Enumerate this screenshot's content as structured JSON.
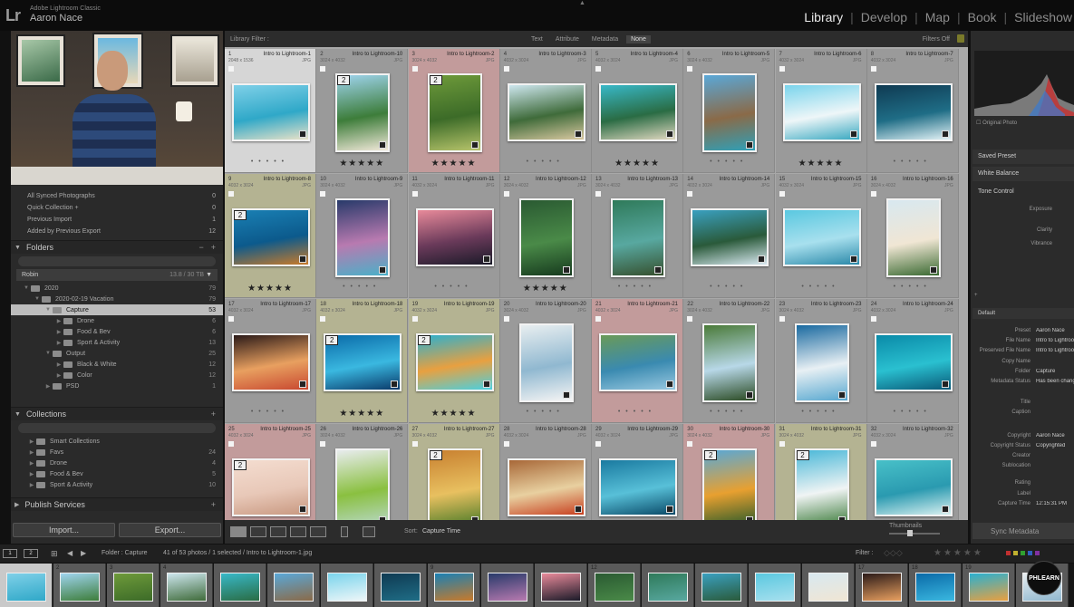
{
  "header": {
    "logo": "Lr",
    "app_name": "Adobe Lightroom Classic",
    "user_name": "Aaron Nace",
    "modules": [
      "Library",
      "Develop",
      "Map",
      "Book",
      "Slideshow"
    ],
    "active_module": "Library"
  },
  "catalog": [
    {
      "label": "All Synced Photographs",
      "count": "0"
    },
    {
      "label": "Quick Collection +",
      "count": "0"
    },
    {
      "label": "Previous Import",
      "count": "1"
    },
    {
      "label": "Added by Previous Export",
      "count": "12"
    }
  ],
  "folders": {
    "title": "Folders",
    "volume": "Robin",
    "volume_space": "13.8 / 30 TB",
    "tree": [
      {
        "name": "2020",
        "count": "79",
        "depth": 1,
        "expanded": true
      },
      {
        "name": "2020-02-19 Vacation",
        "count": "79",
        "depth": 2,
        "expanded": true
      },
      {
        "name": "Capture",
        "count": "53",
        "depth": 3,
        "expanded": true,
        "selected": true
      },
      {
        "name": "Drone",
        "count": "6",
        "depth": 4
      },
      {
        "name": "Food & Bev",
        "count": "6",
        "depth": 4
      },
      {
        "name": "Sport & Activity",
        "count": "13",
        "depth": 4
      },
      {
        "name": "Output",
        "count": "25",
        "depth": 3,
        "expanded": true
      },
      {
        "name": "Black & White",
        "count": "12",
        "depth": 4
      },
      {
        "name": "Color",
        "count": "12",
        "depth": 4
      },
      {
        "name": "PSD",
        "count": "1",
        "depth": 3
      }
    ]
  },
  "collections": {
    "title": "Collections",
    "items": [
      {
        "name": "Smart Collections",
        "count": ""
      },
      {
        "name": "Favs",
        "count": "24"
      },
      {
        "name": "Drone",
        "count": "4"
      },
      {
        "name": "Food & Bev",
        "count": "5"
      },
      {
        "name": "Sport & Activity",
        "count": "10"
      }
    ]
  },
  "publish": {
    "title": "Publish Services"
  },
  "left_buttons": {
    "import": "Import...",
    "export": "Export..."
  },
  "filter_bar": {
    "title": "Library Filter :",
    "options": [
      "Text",
      "Attribute",
      "Metadata",
      "None"
    ],
    "active": "None",
    "status": "Filters Off"
  },
  "grid": {
    "cells": [
      {
        "n": "1",
        "title": "Intro to Lightroom-1",
        "dim": "2048 x 1536",
        "ext": "JPG",
        "stars": 0,
        "tint": "selected",
        "stack": "",
        "colors": [
          "#7fd0e8",
          "#2fa8c8",
          "#e9e2c8"
        ],
        "orient": "landscape"
      },
      {
        "n": "2",
        "title": "Intro to Lightroom-10",
        "dim": "3024 x 4032",
        "ext": "JPG",
        "stars": 5,
        "tint": "",
        "stack": "2",
        "colors": [
          "#9fd4ee",
          "#3d7d3a",
          "#f0e8d8"
        ],
        "orient": "portrait"
      },
      {
        "n": "3",
        "title": "Intro to Lightroom-2",
        "dim": "3024 x 4032",
        "ext": "JPG",
        "stars": 5,
        "tint": "red",
        "stack": "2",
        "colors": [
          "#6e9a3a",
          "#3c6b28",
          "#b7c46b"
        ],
        "orient": "portrait"
      },
      {
        "n": "4",
        "title": "Intro to Lightroom-3",
        "dim": "4032 x 3024",
        "ext": "JPG",
        "stars": 0,
        "tint": "",
        "stack": "",
        "colors": [
          "#cde6ee",
          "#3f6b3a",
          "#d8c8a0"
        ],
        "orient": "landscape"
      },
      {
        "n": "5",
        "title": "Intro to Lightroom-4",
        "dim": "4032 x 3024",
        "ext": "JPG",
        "stars": 5,
        "tint": "",
        "stack": "",
        "colors": [
          "#38b8c8",
          "#2a6c44",
          "#e0d8c0"
        ],
        "orient": "landscape"
      },
      {
        "n": "6",
        "title": "Intro to Lightroom-5",
        "dim": "3024 x 4032",
        "ext": "JPG",
        "stars": 0,
        "tint": "",
        "stack": "",
        "colors": [
          "#5aa8d8",
          "#8a6a48",
          "#2fa0b8"
        ],
        "orient": "portrait"
      },
      {
        "n": "7",
        "title": "Intro to Lightroom-6",
        "dim": "4032 x 3024",
        "ext": "JPG",
        "stars": 5,
        "tint": "",
        "stack": "",
        "colors": [
          "#7ad4ec",
          "#eef6f8",
          "#38a8c0"
        ],
        "orient": "landscape"
      },
      {
        "n": "8",
        "title": "Intro to Lightroom-7",
        "dim": "4032 x 3024",
        "ext": "JPG",
        "stars": 0,
        "tint": "",
        "stack": "",
        "colors": [
          "#0f3a52",
          "#1f6d86",
          "#e2f2f6"
        ],
        "orient": "landscape"
      },
      {
        "n": "9",
        "title": "Intro to Lightroom-8",
        "dim": "4032 x 3024",
        "ext": "JPG",
        "stars": 5,
        "tint": "green",
        "stack": "2",
        "colors": [
          "#1a80b4",
          "#0c5a8c",
          "#c87a2a"
        ],
        "orient": "landscape"
      },
      {
        "n": "10",
        "title": "Intro to Lightroom-9",
        "dim": "3024 x 4032",
        "ext": "JPG",
        "stars": 0,
        "tint": "",
        "stack": "",
        "colors": [
          "#283a6a",
          "#b87ab0",
          "#4ab0c8"
        ],
        "orient": "portrait"
      },
      {
        "n": "11",
        "title": "Intro to Lightroom-11",
        "dim": "4032 x 3024",
        "ext": "JPG",
        "stars": 0,
        "tint": "",
        "stack": "",
        "colors": [
          "#e88a9a",
          "#6a3a5a",
          "#1a1a28"
        ],
        "orient": "landscape"
      },
      {
        "n": "12",
        "title": "Intro to Lightroom-12",
        "dim": "3024 x 4032",
        "ext": "JPG",
        "stars": 5,
        "tint": "",
        "stack": "",
        "colors": [
          "#2a5a32",
          "#4a8a48",
          "#163a1e"
        ],
        "orient": "portrait"
      },
      {
        "n": "13",
        "title": "Intro to Lightroom-13",
        "dim": "3024 x 4032",
        "ext": "JPG",
        "stars": 0,
        "tint": "",
        "stack": "",
        "colors": [
          "#2f7a5a",
          "#58a8a0",
          "#36502e"
        ],
        "orient": "portrait"
      },
      {
        "n": "14",
        "title": "Intro to Lightroom-14",
        "dim": "4032 x 3024",
        "ext": "JPG",
        "stars": 0,
        "tint": "",
        "stack": "",
        "colors": [
          "#3aa0c0",
          "#2a5a3a",
          "#d8e8f0"
        ],
        "orient": "landscape"
      },
      {
        "n": "15",
        "title": "Intro to Lightroom-15",
        "dim": "4032 x 3024",
        "ext": "JPG",
        "stars": 0,
        "tint": "",
        "stack": "",
        "colors": [
          "#5ac8e0",
          "#a8e0ee",
          "#2a88a8"
        ],
        "orient": "landscape"
      },
      {
        "n": "16",
        "title": "Intro to Lightroom-16",
        "dim": "3024 x 4032",
        "ext": "JPG",
        "stars": 0,
        "tint": "",
        "stack": "",
        "colors": [
          "#d8e8f0",
          "#f0e6d4",
          "#3a6a32"
        ],
        "orient": "portrait"
      },
      {
        "n": "17",
        "title": "Intro to Lightroom-17",
        "dim": "4032 x 3024",
        "ext": "JPG",
        "stars": 0,
        "tint": "",
        "stack": "",
        "colors": [
          "#2a1a18",
          "#e8a060",
          "#c84830"
        ],
        "orient": "landscape"
      },
      {
        "n": "18",
        "title": "Intro to Lightroom-18",
        "dim": "4032 x 3024",
        "ext": "JPG",
        "stars": 5,
        "tint": "green",
        "stack": "2",
        "colors": [
          "#0a6aa8",
          "#3ab8e0",
          "#0a3a6a"
        ],
        "orient": "landscape"
      },
      {
        "n": "19",
        "title": "Intro to Lightroom-19",
        "dim": "4032 x 3024",
        "ext": "JPG",
        "stars": 5,
        "tint": "green",
        "stack": "2",
        "colors": [
          "#2ab0d0",
          "#e8a040",
          "#4ad0e0"
        ],
        "orient": "landscape"
      },
      {
        "n": "20",
        "title": "Intro to Lightroom-20",
        "dim": "3024 x 4032",
        "ext": "JPG",
        "stars": 0,
        "tint": "",
        "stack": "",
        "colors": [
          "#e8eef0",
          "#90b8d0",
          "#f4f4f4"
        ],
        "orient": "portrait"
      },
      {
        "n": "21",
        "title": "Intro to Lightroom-21",
        "dim": "4032 x 3024",
        "ext": "JPG",
        "stars": 0,
        "tint": "red",
        "stack": "",
        "colors": [
          "#6a9a58",
          "#3a8ab0",
          "#98c8e0"
        ],
        "orient": "landscape"
      },
      {
        "n": "22",
        "title": "Intro to Lightroom-22",
        "dim": "3024 x 4032",
        "ext": "JPG",
        "stars": 0,
        "tint": "",
        "stack": "",
        "colors": [
          "#4a7a38",
          "#b8d8e8",
          "#2a4a22"
        ],
        "orient": "portrait"
      },
      {
        "n": "23",
        "title": "Intro to Lightroom-23",
        "dim": "3024 x 4032",
        "ext": "JPG",
        "stars": 0,
        "tint": "",
        "stack": "",
        "colors": [
          "#1a6aa0",
          "#e8f0f4",
          "#58a8d0"
        ],
        "orient": "portrait"
      },
      {
        "n": "24",
        "title": "Intro to Lightroom-24",
        "dim": "4032 x 3024",
        "ext": "JPG",
        "stars": 0,
        "tint": "",
        "stack": "",
        "colors": [
          "#0a8aa8",
          "#2ac0d0",
          "#0a5a78"
        ],
        "orient": "landscape"
      },
      {
        "n": "25",
        "title": "Intro to Lightroom-25",
        "dim": "4032 x 3024",
        "ext": "JPG",
        "stars": 0,
        "tint": "red",
        "stack": "2",
        "colors": [
          "#f4ddd0",
          "#e8c8b8",
          "#c89880"
        ],
        "orient": "landscape"
      },
      {
        "n": "26",
        "title": "Intro to Lightroom-26",
        "dim": "3024 x 4032",
        "ext": "JPG",
        "stars": 0,
        "tint": "",
        "stack": "",
        "colors": [
          "#e8ecee",
          "#8ac040",
          "#b8d8c8"
        ],
        "orient": "portrait"
      },
      {
        "n": "27",
        "title": "Intro to Lightroom-27",
        "dim": "3024 x 4032",
        "ext": "JPG",
        "stars": 0,
        "tint": "green",
        "stack": "2",
        "colors": [
          "#c88030",
          "#e8c060",
          "#4a7a28"
        ],
        "orient": "portrait"
      },
      {
        "n": "28",
        "title": "Intro to Lightroom-28",
        "dim": "4032 x 3024",
        "ext": "JPG",
        "stars": 0,
        "tint": "",
        "stack": "",
        "colors": [
          "#a86838",
          "#e8d0a0",
          "#c84020"
        ],
        "orient": "landscape"
      },
      {
        "n": "29",
        "title": "Intro to Lightroom-29",
        "dim": "4032 x 3024",
        "ext": "JPG",
        "stars": 0,
        "tint": "",
        "stack": "",
        "colors": [
          "#1a7aa0",
          "#58c0d8",
          "#0a4a68"
        ],
        "orient": "landscape"
      },
      {
        "n": "30",
        "title": "Intro to Lightroom-30",
        "dim": "3024 x 4032",
        "ext": "JPG",
        "stars": 0,
        "tint": "red",
        "stack": "2",
        "colors": [
          "#58a8d8",
          "#e8a030",
          "#2a5a2a"
        ],
        "orient": "portrait"
      },
      {
        "n": "31",
        "title": "Intro to Lightroom-31",
        "dim": "3024 x 4032",
        "ext": "JPG",
        "stars": 0,
        "tint": "green",
        "stack": "2",
        "colors": [
          "#4ab8d8",
          "#f0f4f4",
          "#3a7a38"
        ],
        "orient": "portrait"
      },
      {
        "n": "32",
        "title": "Intro to Lightroom-32",
        "dim": "4032 x 3024",
        "ext": "JPG",
        "stars": 0,
        "tint": "",
        "stack": "",
        "colors": [
          "#48c0c8",
          "#2a9ab0",
          "#d8f0f0"
        ],
        "orient": "landscape"
      }
    ]
  },
  "toolbar": {
    "sort_label": "Sort:",
    "sort_value": "Capture Time",
    "thumbnails_label": "Thumbnails"
  },
  "right_panel": {
    "original_photo": "Original Photo",
    "sections": [
      "Saved Preset",
      "White Balance",
      "Tone Control"
    ],
    "sliders": [
      "Exposure",
      "Clarity",
      "Vibrance"
    ],
    "default_label": "Default",
    "metadata": [
      {
        "k": "Preset",
        "v": "Aaron Nace"
      },
      {
        "k": "File Name",
        "v": "Intro to Lightroom-1.jpg"
      },
      {
        "k": "Preserved File Name",
        "v": "Intro to Lightroom-1.jpg"
      },
      {
        "k": "Copy Name",
        "v": ""
      },
      {
        "k": "Folder",
        "v": "Capture"
      },
      {
        "k": "Metadata Status",
        "v": "Has been changed"
      },
      {
        "k": "Title",
        "v": ""
      },
      {
        "k": "Caption",
        "v": ""
      },
      {
        "k": "Copyright",
        "v": "Aaron Nace"
      },
      {
        "k": "Copyright Status",
        "v": "Copyrighted"
      },
      {
        "k": "Creator",
        "v": ""
      },
      {
        "k": "Sublocation",
        "v": ""
      },
      {
        "k": "Rating",
        "v": ""
      },
      {
        "k": "Label",
        "v": ""
      },
      {
        "k": "Capture Time",
        "v": "12:15:31 PM"
      }
    ],
    "sync_metadata": "Sync Metadata"
  },
  "filmstrip_bar": {
    "path": "Folder : Capture",
    "count": "41 of 53 photos / 1 selected / Intro to Lightroom-1.jpg",
    "filter_label": "Filter :",
    "label_colors": [
      "#c03030",
      "#c0b030",
      "#30a030",
      "#3060c0",
      "#8030a0"
    ]
  },
  "filmstrip": [
    {
      "n": "",
      "colors": [
        "#7fd0e8",
        "#2fa8c8"
      ]
    },
    {
      "n": "2",
      "colors": [
        "#9fd4ee",
        "#3d7d3a"
      ]
    },
    {
      "n": "3",
      "colors": [
        "#6e9a3a",
        "#3c6b28"
      ]
    },
    {
      "n": "4",
      "colors": [
        "#cde6ee",
        "#3f6b3a"
      ]
    },
    {
      "n": "",
      "colors": [
        "#38b8c8",
        "#2a6c44"
      ]
    },
    {
      "n": "",
      "colors": [
        "#5aa8d8",
        "#8a6a48"
      ]
    },
    {
      "n": "",
      "colors": [
        "#7ad4ec",
        "#eef6f8"
      ]
    },
    {
      "n": "",
      "colors": [
        "#0f3a52",
        "#1f6d86"
      ]
    },
    {
      "n": "9",
      "colors": [
        "#1a80b4",
        "#c87a2a"
      ]
    },
    {
      "n": "",
      "colors": [
        "#283a6a",
        "#b87ab0"
      ]
    },
    {
      "n": "",
      "colors": [
        "#e88a9a",
        "#1a1a28"
      ]
    },
    {
      "n": "12",
      "colors": [
        "#2a5a32",
        "#4a8a48"
      ]
    },
    {
      "n": "",
      "colors": [
        "#2f7a5a",
        "#58a8a0"
      ]
    },
    {
      "n": "",
      "colors": [
        "#3aa0c0",
        "#2a5a3a"
      ]
    },
    {
      "n": "",
      "colors": [
        "#5ac8e0",
        "#a8e0ee"
      ]
    },
    {
      "n": "",
      "colors": [
        "#d8e8f0",
        "#f0e6d4"
      ]
    },
    {
      "n": "17",
      "colors": [
        "#2a1a18",
        "#e8a060"
      ]
    },
    {
      "n": "18",
      "colors": [
        "#0a6aa8",
        "#3ab8e0"
      ]
    },
    {
      "n": "19",
      "colors": [
        "#2ab0d0",
        "#e8a040"
      ]
    },
    {
      "n": "",
      "colors": [
        "#e8eef0",
        "#90b8d0"
      ]
    }
  ],
  "watermark": "PHLEARN"
}
